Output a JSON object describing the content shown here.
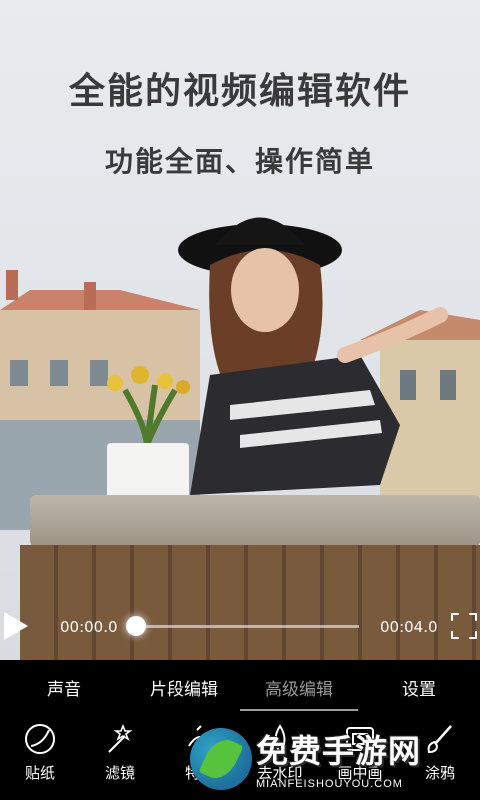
{
  "headline": {
    "title": "全能的视频编辑软件",
    "subtitle": "功能全面、操作简单"
  },
  "player": {
    "current_time": "00:00.0",
    "end_time": "00:04.0",
    "progress": 0.0
  },
  "tabs": [
    {
      "label": "声音",
      "active": false
    },
    {
      "label": "片段编辑",
      "active": false
    },
    {
      "label": "高级编辑",
      "active": true
    },
    {
      "label": "设置",
      "active": false
    }
  ],
  "tools": [
    {
      "label": "贴纸",
      "icon": "sticker-icon"
    },
    {
      "label": "滤镜",
      "icon": "filter-wand-icon"
    },
    {
      "label": "特效",
      "icon": "effects-icon"
    },
    {
      "label": "去水印",
      "icon": "remove-watermark-icon"
    },
    {
      "label": "画中画",
      "icon": "picture-in-picture-icon"
    },
    {
      "label": "涂鸦",
      "icon": "brush-icon"
    }
  ],
  "watermark": {
    "title": "免费手游网",
    "url": "MIANFEISHOUYOU.COM"
  },
  "colors": {
    "bar_background": "#000000",
    "active_tab": "#9a9a9a",
    "text": "#ffffff"
  }
}
